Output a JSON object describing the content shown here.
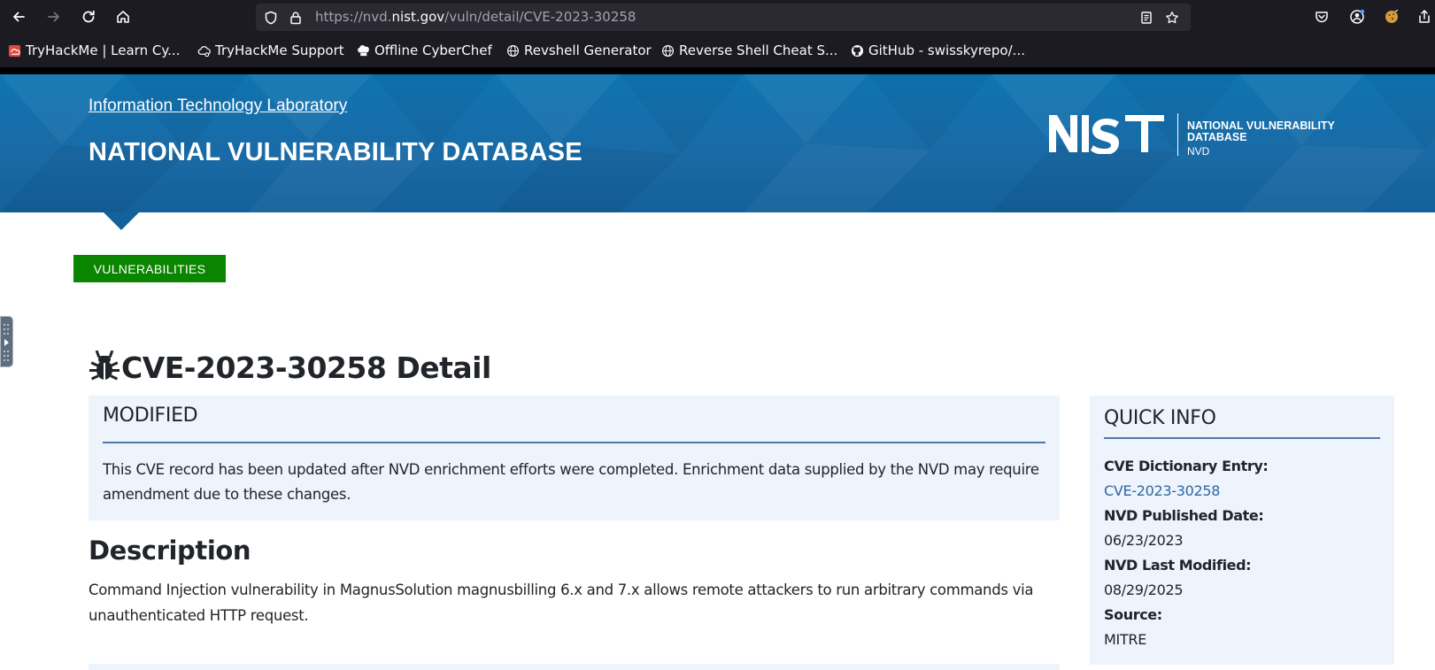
{
  "browser": {
    "url_scheme": "https://nvd.",
    "url_host": "nist.gov",
    "url_path": "/vuln/detail/CVE-2023-30258",
    "bookmarks": [
      {
        "label": "TryHackMe | Learn Cy...",
        "icon": "tryhackme-icon"
      },
      {
        "label": "TryHackMe Support",
        "icon": "support-cloud-icon"
      },
      {
        "label": "Offline CyberChef",
        "icon": "chef-hat-icon"
      },
      {
        "label": "Revshell Generator",
        "icon": "globe-icon"
      },
      {
        "label": "Reverse Shell Cheat S...",
        "icon": "globe-icon"
      },
      {
        "label": "GitHub - swisskyrepo/...",
        "icon": "github-icon"
      }
    ]
  },
  "banner": {
    "itl_link": "Information Technology Laboratory",
    "title": "NATIONAL VULNERABILITY DATABASE",
    "logo_text_line1": "NATIONAL VULNERABILITY",
    "logo_text_line2": "DATABASE",
    "logo_text_line3": "NVD"
  },
  "nav": {
    "vulnerabilities_label": "VULNERABILITIES"
  },
  "page": {
    "title": "CVE-2023-30258 Detail",
    "modified": {
      "heading": "MODIFIED",
      "text": "This CVE record has been updated after NVD enrichment efforts were completed. Enrichment data supplied by the NVD may require amendment due to these changes."
    },
    "description": {
      "heading": "Description",
      "text": "Command Injection vulnerability in MagnusSolution magnusbilling 6.x and 7.x allows remote attackers to run arbitrary commands via unauthenticated HTTP request."
    }
  },
  "quick_info": {
    "heading": "QUICK INFO",
    "cve_entry_label": "CVE Dictionary Entry:",
    "cve_entry_value": "CVE-2023-30258",
    "published_label": "NVD Published Date:",
    "published_value": "06/23/2023",
    "modified_label": "NVD Last Modified:",
    "modified_value": "08/29/2025",
    "source_label": "Source:",
    "source_value": "MITRE"
  },
  "colors": {
    "banner_blue": "#1a6aa6",
    "vuln_button_green": "#0a8500",
    "panel_bg": "#eef4fb",
    "link_blue": "#3166a2"
  }
}
